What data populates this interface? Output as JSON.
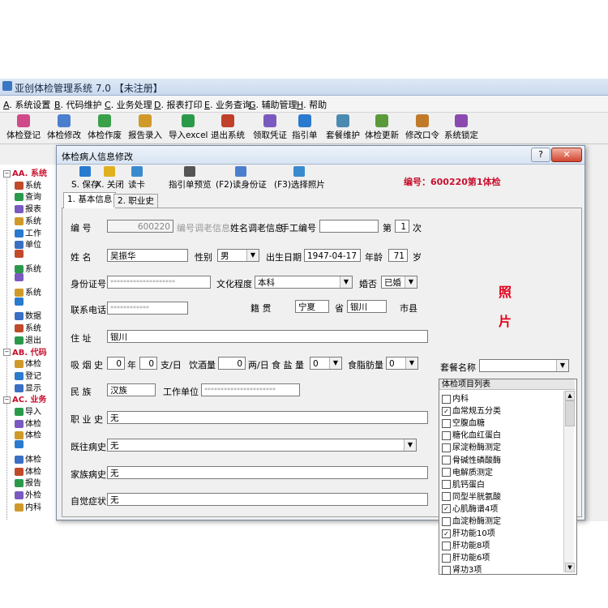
{
  "app_title": "亚创体检管理系统 7.0 【未注册】",
  "menu": [
    {
      "key": "A",
      "label": "系统设置"
    },
    {
      "key": "B",
      "label": "代码维护"
    },
    {
      "key": "C",
      "label": "业务处理"
    },
    {
      "key": "D",
      "label": "报表打印"
    },
    {
      "key": "E",
      "label": "业务查询"
    },
    {
      "key": "G",
      "label": "辅助管理"
    },
    {
      "key": "H",
      "label": "帮助"
    }
  ],
  "toolbar": [
    {
      "label": "体检登记",
      "icon": "register-icon",
      "color": "#d04a8a"
    },
    {
      "label": "体检修改",
      "icon": "edit-icon",
      "color": "#4a7fd0"
    },
    {
      "label": "体检作废",
      "icon": "void-icon",
      "color": "#3aa04a"
    },
    {
      "label": "报告录入",
      "icon": "report-entry-icon",
      "color": "#d09a2a"
    },
    {
      "label": "导入excel",
      "icon": "import-excel-icon",
      "color": "#2a9a4a"
    },
    {
      "label": "退出系统",
      "icon": "exit-icon",
      "color": "#c0402a"
    },
    {
      "label": "领取凭证",
      "icon": "voucher-icon",
      "color": "#7a5ac0"
    },
    {
      "label": "指引单",
      "icon": "guide-icon",
      "color": "#2a7ad0"
    },
    {
      "label": "套餐维护",
      "icon": "package-icon",
      "color": "#4a8ab0"
    },
    {
      "label": "体检更新",
      "icon": "update-icon",
      "color": "#5a9a3a"
    },
    {
      "label": "修改口令",
      "icon": "password-icon",
      "color": "#c07a2a"
    },
    {
      "label": "系统锁定",
      "icon": "lock-icon",
      "color": "#8a4ab0"
    }
  ],
  "tree": [
    {
      "label": "AA. 系统",
      "header": true
    },
    {
      "label": "系统"
    },
    {
      "label": "查询"
    },
    {
      "label": "报表"
    },
    {
      "label": "系统"
    },
    {
      "label": "工作"
    },
    {
      "label": "单位"
    },
    {
      "label": ""
    },
    {
      "label": "系统"
    },
    {
      "label": ""
    },
    {
      "label": "系统"
    },
    {
      "label": ""
    },
    {
      "label": "数据"
    },
    {
      "label": "系统"
    },
    {
      "label": "退出"
    },
    {
      "label": "AB. 代码",
      "header": true
    },
    {
      "label": "体检"
    },
    {
      "label": "登记"
    },
    {
      "label": "显示"
    },
    {
      "label": "AC. 业务",
      "header": true
    },
    {
      "label": "导入"
    },
    {
      "label": "体检"
    },
    {
      "label": "体检"
    },
    {
      "label": ""
    },
    {
      "label": "体检"
    },
    {
      "label": "体检"
    },
    {
      "label": "报告"
    },
    {
      "label": "外检"
    },
    {
      "label": "内科"
    }
  ],
  "dialog": {
    "title": "体检病人信息修改",
    "help_btn": "?",
    "close_btn": "✕",
    "toolbar": [
      {
        "key": "S",
        "label": "保存",
        "icon": "save-icon"
      },
      {
        "key": "X",
        "label": "关闭",
        "icon": "close-icon"
      },
      {
        "key": "",
        "label": "读卡",
        "icon": "card-reader-icon"
      },
      {
        "key": "",
        "label": "指引单预览",
        "icon": "print-preview-icon"
      },
      {
        "key": "",
        "label": "(F2)读身份证",
        "icon": "id-card-icon"
      },
      {
        "key": "",
        "label": "(F3)选择照片",
        "icon": "photo-icon"
      }
    ],
    "reg_info": "编号：600220第1体检",
    "tabs": [
      {
        "key": "1",
        "label": "基本信息"
      },
      {
        "key": "2",
        "label": "职业史"
      }
    ],
    "form": {
      "id_label": "编 号",
      "id_value": "600220",
      "adjust_hint": "编号调老信息",
      "name_adjust_label": "姓名调老信息",
      "manual_no_label": "手工编号",
      "manual_no_value": "",
      "times_prefix": "第",
      "times_value": "1",
      "times_suffix": "次",
      "name_label": "姓 名",
      "name_value": "吴振华",
      "gender_label": "性别",
      "gender_value": "男",
      "birth_label": "出生日期",
      "birth_value": "1947-04-17",
      "age_label": "年龄",
      "age_value": "71",
      "age_unit": "岁",
      "idcard_label": "身份证号",
      "idcard_value": "********************",
      "edu_label": "文化程度",
      "edu_value": "本科",
      "married_label": "婚否",
      "married_value": "已婚",
      "phone_label": "联系电话",
      "phone_value": "************",
      "native_label": "籍 贯",
      "native_value": "宁夏",
      "province_label": "省",
      "city_value": "银川",
      "city_label": "市县",
      "address_label": "住 址",
      "address_value": "银川",
      "smoke_label": "吸 烟 史",
      "smoke_years": "0",
      "smoke_years_unit": "年",
      "smoke_daily": "0",
      "smoke_daily_unit": "支/日",
      "drink_label": "饮酒量",
      "drink_value": "0",
      "drink_unit": "两/日",
      "salt_label": "食 盐 量",
      "salt_value": "0",
      "fat_label": "食脂肪量",
      "fat_value": "0",
      "nation_label": "民 族",
      "nation_value": "汉族",
      "workplace_label": "工作单位",
      "workplace_value": "**********************",
      "occupation_label": "职 业 史",
      "occupation_value": "无",
      "past_label": "既往病史",
      "past_value": "无",
      "family_label": "家族病史",
      "family_value": "无",
      "symptom_label": "自觉症状",
      "symptom_value": "无",
      "photo_line1": "照",
      "photo_line2": "片",
      "package_label": "套餐名称",
      "package_value": "",
      "items_header": "体检项目列表",
      "items": [
        {
          "label": "内科",
          "checked": false
        },
        {
          "label": "血常规五分类",
          "checked": true
        },
        {
          "label": "空腹血糖",
          "checked": false
        },
        {
          "label": "糖化血红蛋白",
          "checked": false
        },
        {
          "label": "尿淀粉酶测定",
          "checked": false
        },
        {
          "label": "骨碱性磷酸酶",
          "checked": false
        },
        {
          "label": "电解质测定",
          "checked": false
        },
        {
          "label": "肌钙蛋白",
          "checked": false
        },
        {
          "label": "同型半胱氨酸",
          "checked": false
        },
        {
          "label": "心肌酶谱4项",
          "checked": true
        },
        {
          "label": "血淀粉酶测定",
          "checked": false
        },
        {
          "label": "肝功能10项",
          "checked": true
        },
        {
          "label": "肝功能8项",
          "checked": false
        },
        {
          "label": "肝功能6项",
          "checked": false
        },
        {
          "label": "肾功3项",
          "checked": false
        }
      ]
    }
  }
}
